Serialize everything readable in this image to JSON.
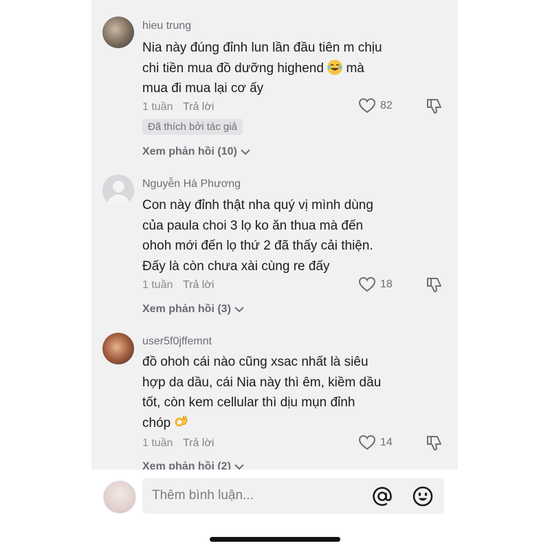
{
  "comments": [
    {
      "username": "hieu trung",
      "lines": [
        "Nia này đúng đỉnh lun lần đầu tiên m chịu",
        "chi tiền mua đồ dưỡng highend",
        "mua đi mua lại cơ ấy"
      ],
      "line2_suffix": " mà",
      "emoji_icon": "face-with-tears-of-joy-icon",
      "time": "1 tuần",
      "reply": "Trả lời",
      "likes": "82",
      "badge": "Đã thích bởi tác giả",
      "view_replies": "Xem phản hồi (10)"
    },
    {
      "username": "Nguyễn Hà Phương",
      "lines": [
        "Con này đỉnh thật nha quý vị mình dùng",
        "của paula choi 3 lọ ko ăn thua mà đến",
        "ohoh mới đến lọ thứ 2 đã thấy cải thiện.",
        "Đấy là còn chưa xài cùng re đấy"
      ],
      "time": "1 tuần",
      "reply": "Trả lời",
      "likes": "18",
      "view_replies": "Xem phản hồi (3)"
    },
    {
      "username": "user5f0jffemnt",
      "lines": [
        "đồ ohoh cái nào cũng xsac nhất là siêu",
        "hợp da dầu, cái Nia này thì êm, kiềm dầu",
        "tốt, còn kem cellular thì dịu mụn đỉnh",
        "chóp"
      ],
      "emoji_icon": "ok-hand-icon",
      "time": "1 tuần",
      "reply": "Trả lời",
      "likes": "14",
      "view_replies": "Xem phản hồi (2)"
    }
  ],
  "input": {
    "placeholder": "Thêm bình luận..."
  }
}
